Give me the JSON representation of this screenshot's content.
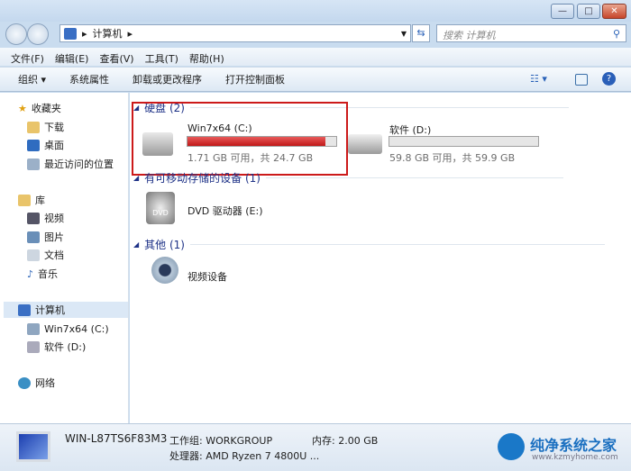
{
  "window": {
    "minimize": "—",
    "maximize": "□",
    "close": "✕"
  },
  "address": {
    "crumbs": [
      "计算机"
    ],
    "search_placeholder": "搜索 计算机"
  },
  "menu": [
    "文件(F)",
    "编辑(E)",
    "查看(V)",
    "工具(T)",
    "帮助(H)"
  ],
  "commands": [
    "组织 ▾",
    "系统属性",
    "卸载或更改程序",
    "打开控制面板"
  ],
  "sidebar": {
    "favorites": "收藏夹",
    "fav_items": [
      "下载",
      "桌面",
      "最近访问的位置"
    ],
    "library": "库",
    "lib_items": [
      "视频",
      "图片",
      "文档",
      "音乐"
    ],
    "computer": "计算机",
    "comp_items": [
      "Win7x64 (C:)",
      "软件 (D:)"
    ],
    "network": "网络"
  },
  "groups": {
    "hdd": "硬盘 (2)",
    "removable": "有可移动存储的设备 (1)",
    "other": "其他 (1)"
  },
  "drives": [
    {
      "name": "Win7x64 (C:)",
      "info": "1.71 GB 可用，共 24.7 GB",
      "used_fraction": 0.93,
      "color": "#c01818"
    },
    {
      "name": "软件 (D:)",
      "info": "59.8 GB 可用，共 59.9 GB",
      "used_fraction": 0.002
    }
  ],
  "dvd": "DVD 驱动器 (E:)",
  "camera": "视频设备",
  "status": {
    "pc": "WIN-L87TS6F83M3",
    "workgroup": "工作组: WORKGROUP",
    "memory": "内存: 2.00 GB",
    "cpu": "处理器: AMD Ryzen 7 4800U ...",
    "watermark": "纯净系统之家",
    "watermark_url": "www.kzmyhome.com"
  },
  "highlight_color": "#cc1a1a"
}
